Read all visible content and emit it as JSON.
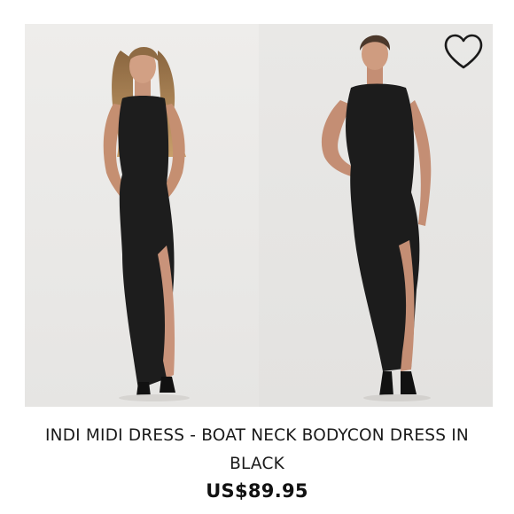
{
  "product": {
    "title": "INDI MIDI DRESS - BOAT NECK BODYCON DRESS IN BLACK",
    "price": "US$89.95",
    "wishlist_icon": "heart-outline-icon",
    "colors": {
      "dress": "#1c1c1c",
      "background": "#ececea",
      "skin": "#c89478",
      "hair_blonde": "#b88d5c",
      "hair_brown": "#4a362a"
    }
  }
}
